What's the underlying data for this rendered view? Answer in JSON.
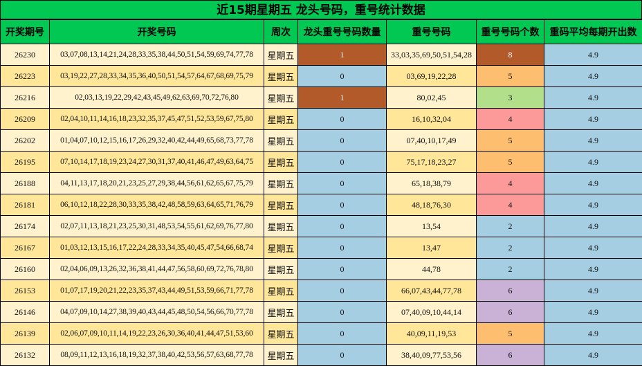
{
  "title": "近15期星期五 龙头号码，重号统计数据",
  "headers": {
    "issue": "开奖期号",
    "numbers": "开奖号码",
    "weekday": "周次",
    "dragon_count": "龙头重号号码数量",
    "repeat_numbers": "重号号码",
    "repeat_count": "重号号码个数",
    "avg": "重码平均每期开出数"
  },
  "colors": {
    "header_green": "#00c853",
    "cell_cream": "#fff2cc",
    "cell_tan": "#ffe699",
    "cell_blue": "#a6cee3",
    "dragon_hit_brown": "#b35a2b",
    "count_orange": "#fdbf6f",
    "count_green": "#b2df8a",
    "count_red": "#fb9a99",
    "count_purple": "#cab2d6"
  },
  "rows": [
    {
      "issue": "26230",
      "numbers": "03,07,08,13,14,21,24,28,33,35,38,44,50,51,54,59,69,74,77,78",
      "weekday": "星期五",
      "dragon": "1",
      "repeat": "33,03,35,69,50,51,54,28",
      "count": "8",
      "avg": "4.9",
      "dragon_color": "#b35a2b",
      "count_color": "#b35a2b"
    },
    {
      "issue": "26223",
      "numbers": "03,19,22,27,28,33,34,35,36,40,50,51,54,57,64,67,68,69,75,79",
      "weekday": "星期五",
      "dragon": "0",
      "repeat": "03,69,19,22,28",
      "count": "5",
      "avg": "4.9",
      "dragon_color": "#a6cee3",
      "count_color": "#fdbf6f"
    },
    {
      "issue": "26216",
      "numbers": "02,03,13,19,22,29,42,43,45,49,62,63,69,70,72,76,80",
      "weekday": "星期五",
      "dragon": "1",
      "repeat": "80,02,45",
      "count": "3",
      "avg": "4.9",
      "dragon_color": "#b35a2b",
      "count_color": "#b2df8a"
    },
    {
      "issue": "26209",
      "numbers": "02,04,10,11,14,16,18,23,32,35,37,45,47,51,52,53,59,67,75,80",
      "weekday": "星期五",
      "dragon": "0",
      "repeat": "16,10,32,04",
      "count": "4",
      "avg": "4.9",
      "dragon_color": "#a6cee3",
      "count_color": "#fb9a99"
    },
    {
      "issue": "26202",
      "numbers": "01,04,07,10,12,15,16,17,26,29,32,40,42,44,49,65,68,73,77,78",
      "weekday": "星期五",
      "dragon": "0",
      "repeat": "07,40,10,17,49",
      "count": "5",
      "avg": "4.9",
      "dragon_color": "#a6cee3",
      "count_color": "#fdbf6f"
    },
    {
      "issue": "26195",
      "numbers": "07,10,14,17,18,19,23,24,27,30,31,37,40,41,46,47,49,63,64,75",
      "weekday": "星期五",
      "dragon": "0",
      "repeat": "75,17,18,23,27",
      "count": "5",
      "avg": "4.9",
      "dragon_color": "#a6cee3",
      "count_color": "#fdbf6f"
    },
    {
      "issue": "26188",
      "numbers": "04,11,13,17,18,20,21,23,25,27,29,38,44,56,61,62,65,67,75,79",
      "weekday": "星期五",
      "dragon": "0",
      "repeat": "65,18,38,79",
      "count": "4",
      "avg": "4.9",
      "dragon_color": "#a6cee3",
      "count_color": "#fb9a99"
    },
    {
      "issue": "26181",
      "numbers": "06,10,12,18,22,28,30,33,35,38,42,48,58,59,63,64,65,71,76,79",
      "weekday": "星期五",
      "dragon": "0",
      "repeat": "48,18,76,30",
      "count": "4",
      "avg": "4.9",
      "dragon_color": "#a6cee3",
      "count_color": "#fb9a99"
    },
    {
      "issue": "26174",
      "numbers": "02,07,11,13,18,21,23,25,30,31,48,53,54,55,61,62,69,76,77,80",
      "weekday": "星期五",
      "dragon": "0",
      "repeat": "13,54",
      "count": "2",
      "avg": "4.9",
      "dragon_color": "#a6cee3",
      "count_color": "#a6cee3"
    },
    {
      "issue": "26167",
      "numbers": "01,03,12,13,15,16,17,22,24,28,33,34,35,40,45,47,54,66,68,74",
      "weekday": "星期五",
      "dragon": "0",
      "repeat": "13,47",
      "count": "2",
      "avg": "4.9",
      "dragon_color": "#a6cee3",
      "count_color": "#a6cee3"
    },
    {
      "issue": "26160",
      "numbers": "02,04,06,09,13,26,32,36,38,41,44,47,56,58,60,69,72,76,78,80",
      "weekday": "星期五",
      "dragon": "0",
      "repeat": "44,78",
      "count": "2",
      "avg": "4.9",
      "dragon_color": "#a6cee3",
      "count_color": "#a6cee3"
    },
    {
      "issue": "26153",
      "numbers": "01,07,17,19,20,21,22,23,35,37,43,44,49,51,53,59,66,71,77,78",
      "weekday": "星期五",
      "dragon": "0",
      "repeat": "66,07,43,44,77,78",
      "count": "6",
      "avg": "4.9",
      "dragon_color": "#a6cee3",
      "count_color": "#cab2d6"
    },
    {
      "issue": "26146",
      "numbers": "04,07,09,10,14,27,38,39,40,43,44,45,48,50,54,56,66,70,77,78",
      "weekday": "星期五",
      "dragon": "0",
      "repeat": "07,40,09,10,44,14",
      "count": "6",
      "avg": "4.9",
      "dragon_color": "#a6cee3",
      "count_color": "#cab2d6"
    },
    {
      "issue": "26139",
      "numbers": "02,06,07,09,10,11,14,19,22,23,26,30,36,40,41,44,47,51,53,60",
      "weekday": "星期五",
      "dragon": "0",
      "repeat": "40,09,11,19,53",
      "count": "5",
      "avg": "4.9",
      "dragon_color": "#a6cee3",
      "count_color": "#fdbf6f"
    },
    {
      "issue": "26132",
      "numbers": "08,09,11,12,13,16,18,19,32,37,38,40,42,53,56,57,63,68,77,78",
      "weekday": "星期五",
      "dragon": "0",
      "repeat": "38,40,09,77,53,56",
      "count": "6",
      "avg": "4.9",
      "dragon_color": "#a6cee3",
      "count_color": "#cab2d6"
    }
  ]
}
